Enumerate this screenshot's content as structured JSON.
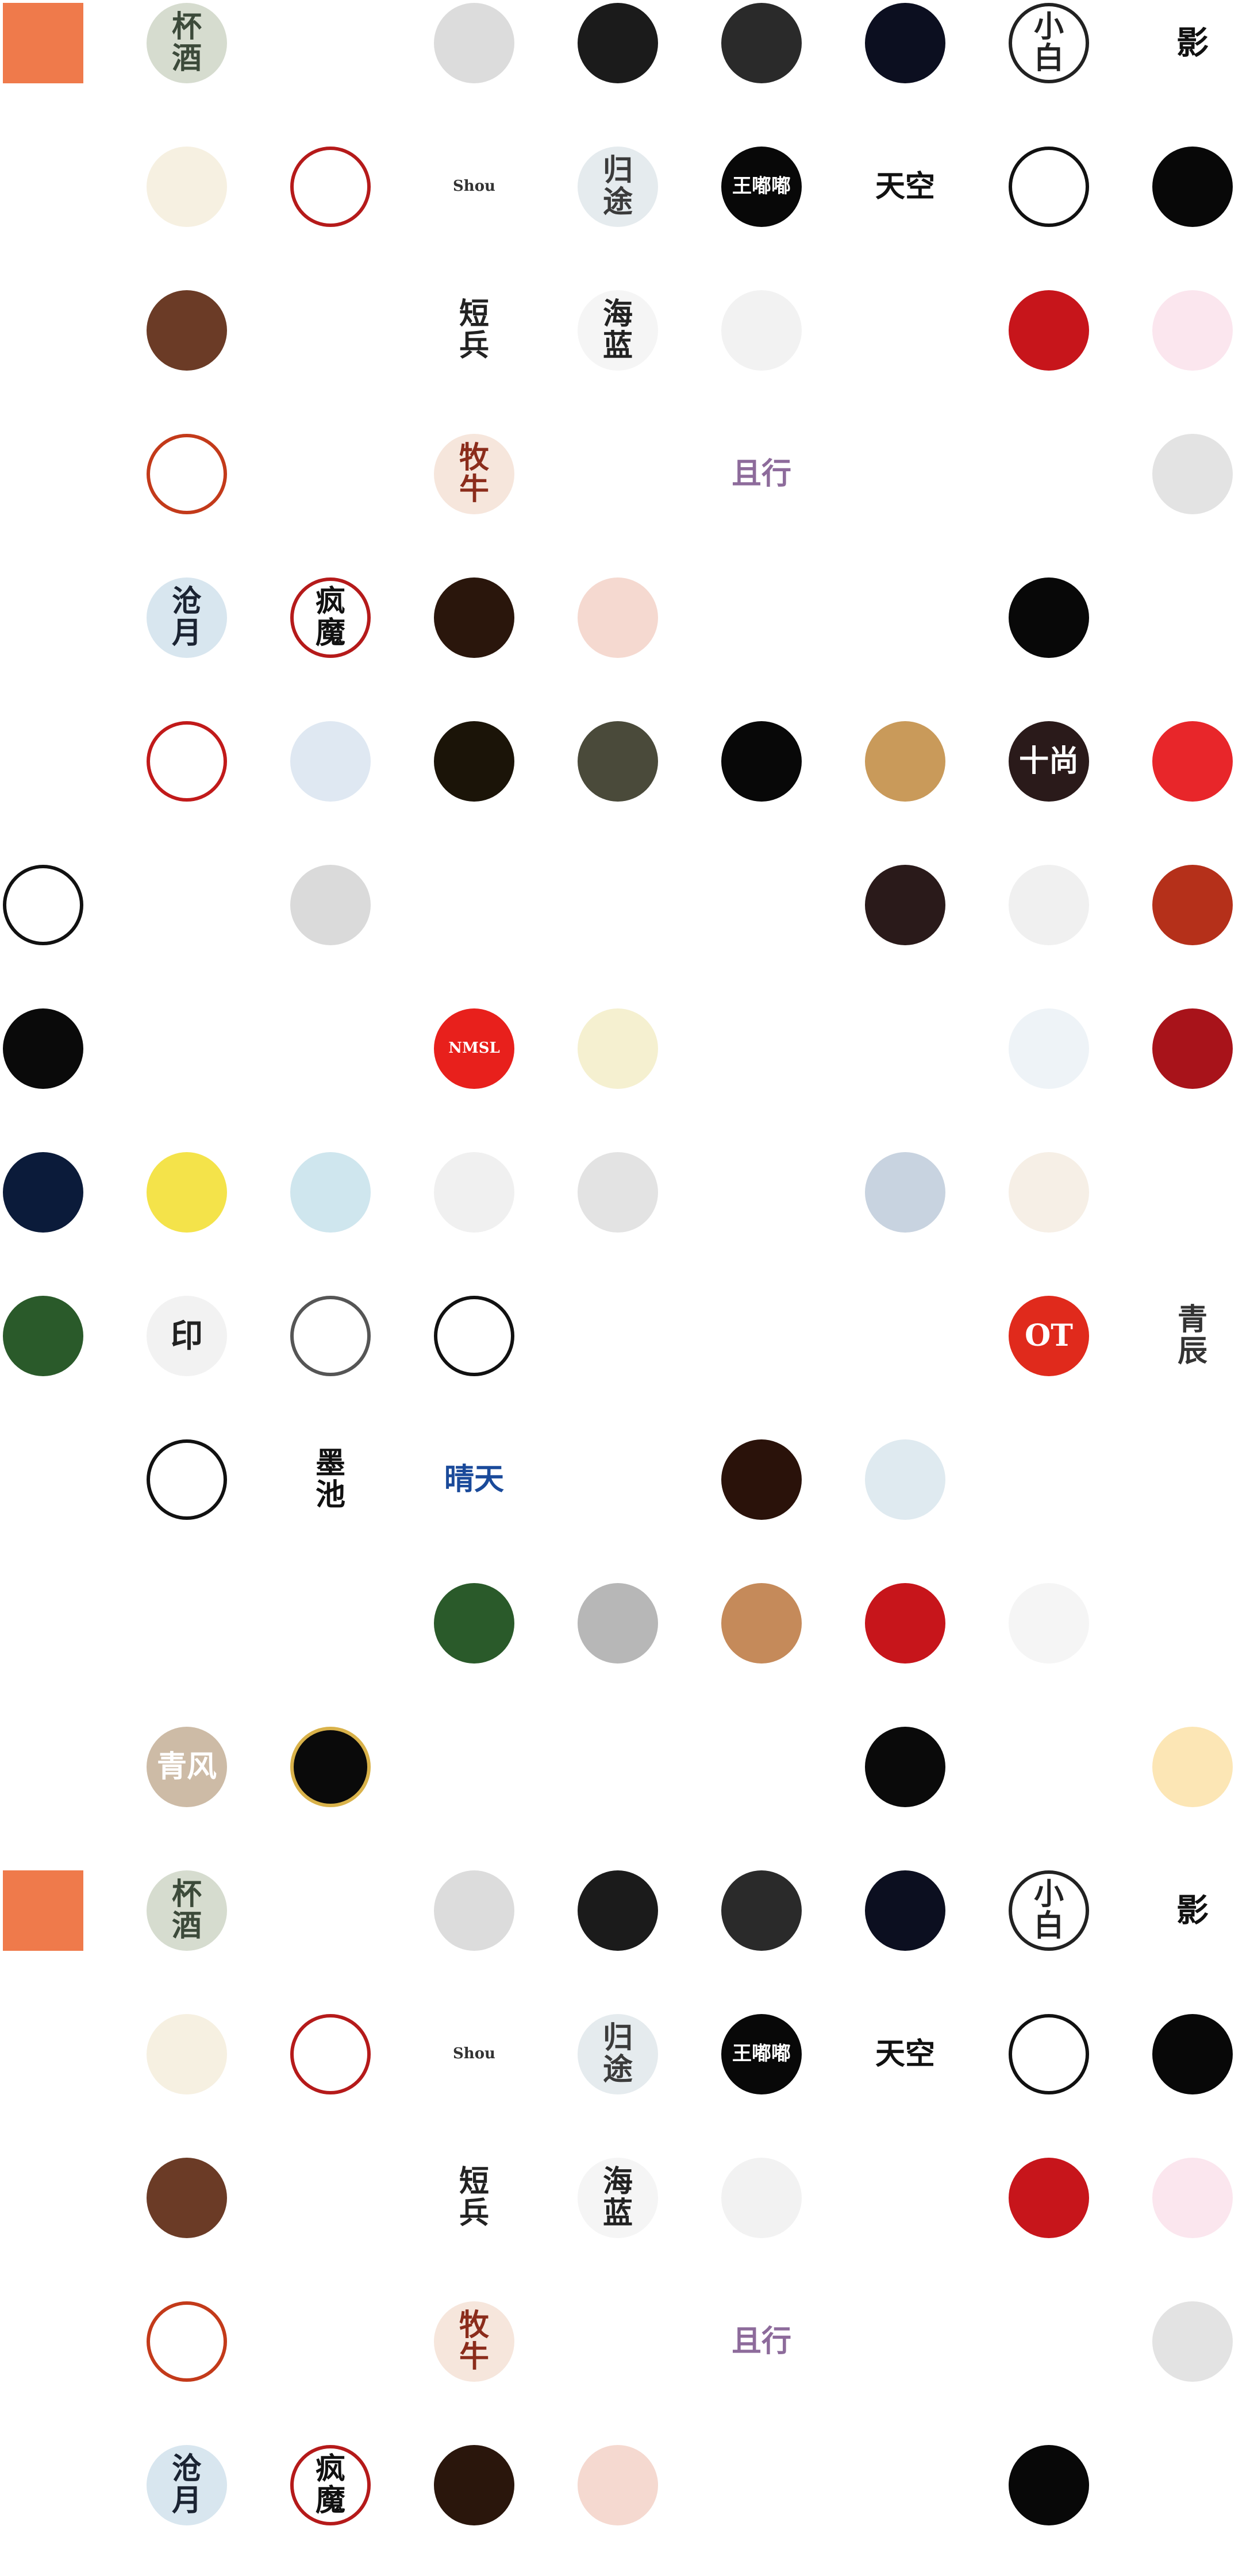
{
  "grid": {
    "columns": 9,
    "rows": 18,
    "items": [
      {
        "label": "",
        "bg": "#ef7a4b",
        "fg": "#3a1a0a",
        "plain": true
      },
      {
        "label": "杯\n酒",
        "bg": "#d6dccf",
        "fg": "#3c4a3a"
      },
      {
        "label": "",
        "bg": "#ffffff",
        "fg": "#9aa3b0"
      },
      {
        "label": "",
        "bg": "#dcdcdc",
        "fg": "#111111"
      },
      {
        "label": "",
        "bg": "#1b1b1b",
        "fg": "#d9b24a"
      },
      {
        "label": "",
        "bg": "#2a2a2a",
        "fg": "#d9b24a"
      },
      {
        "label": "",
        "bg": "#0c0f20",
        "fg": "#c6d4ff"
      },
      {
        "label": "小\n白",
        "bg": "#ffffff",
        "fg": "#222222",
        "border": "#222222"
      },
      {
        "label": "影",
        "bg": "#ffffff",
        "fg": "#111111",
        "plain": true
      },
      {
        "label": "",
        "bg": "#ffffff",
        "fg": "#333333",
        "plain": true
      },
      {
        "label": "",
        "bg": "#f6f0e1",
        "fg": "#b24c2a"
      },
      {
        "label": "",
        "bg": "#ffffff",
        "fg": "#b51a1a",
        "border": "#b51a1a"
      },
      {
        "label": "Shou",
        "bg": "#ffffff",
        "fg": "#333333",
        "plain": true
      },
      {
        "label": "归\n途",
        "bg": "#e5ebee",
        "fg": "#3b3b3b"
      },
      {
        "label": "王嘟嘟",
        "bg": "#080808",
        "fg": "#ffffff"
      },
      {
        "label": "天空",
        "bg": "#ffffff",
        "fg": "#111111"
      },
      {
        "label": "",
        "bg": "#ffffff",
        "fg": "#b51a1a",
        "border": "#111111"
      },
      {
        "label": "",
        "bg": "#080808",
        "fg": "#ffffff"
      },
      {
        "label": "",
        "bg": "#ffffff",
        "fg": "#b8922e",
        "plain": true
      },
      {
        "label": "",
        "bg": "#6b3b26",
        "fg": "#f2c6a1"
      },
      {
        "label": "",
        "bg": "#ffffff",
        "fg": "#222222",
        "plain": true
      },
      {
        "label": "短\n兵",
        "bg": "#ffffff",
        "fg": "#222222"
      },
      {
        "label": "海\n蓝",
        "bg": "#f5f5f5",
        "fg": "#222222"
      },
      {
        "label": "",
        "bg": "#f2f2f2",
        "fg": "#222222"
      },
      {
        "label": "",
        "bg": "#ffffff",
        "fg": "#222222"
      },
      {
        "label": "",
        "bg": "#c7151b",
        "fg": "#f1c84a"
      },
      {
        "label": "",
        "bg": "#fbe6ee",
        "fg": "#c65a7b"
      },
      {
        "label": "",
        "bg": "#ffffff",
        "fg": "#c28a2a",
        "plain": true
      },
      {
        "label": "",
        "bg": "#ffffff",
        "fg": "#c33a1a",
        "border": "#c33a1a"
      },
      {
        "label": "",
        "bg": "#ffffff",
        "fg": "#6aa6a1",
        "plain": true
      },
      {
        "label": "牧\n牛",
        "bg": "#f6e6dc",
        "fg": "#8b2c1b"
      },
      {
        "label": "",
        "bg": "#ffffff",
        "fg": "#263a7a"
      },
      {
        "label": "且行",
        "bg": "#ffffff",
        "fg": "#8d6b9b",
        "plain": true
      },
      {
        "label": "",
        "bg": "#ffffff",
        "fg": "#222222"
      },
      {
        "label": "",
        "bg": "#ffffff",
        "fg": "#222222"
      },
      {
        "label": "",
        "bg": "#e3e3e3",
        "fg": "#555555"
      },
      {
        "label": "",
        "bg": "#ffffff",
        "fg": "#b51a1a",
        "plain": true
      },
      {
        "label": "沧\n月",
        "bg": "#d8e6ef",
        "fg": "#1b2433"
      },
      {
        "label": "疯\n魔",
        "bg": "#ffffff",
        "fg": "#111111",
        "border": "#b51a1a"
      },
      {
        "label": "",
        "bg": "#2a160c",
        "fg": "#d0762a"
      },
      {
        "label": "",
        "bg": "#f5d9d0",
        "fg": "#3a2a1a"
      },
      {
        "label": "",
        "bg": "#ffffff",
        "fg": "#3a5a2a"
      },
      {
        "label": "",
        "bg": "#ffffff",
        "fg": "#c39a2a"
      },
      {
        "label": "",
        "bg": "#080808",
        "fg": "#d9b24a"
      },
      {
        "label": "",
        "bg": "#ffffff",
        "fg": "#d85a5a",
        "plain": true
      },
      {
        "label": "",
        "bg": "#ffffff",
        "fg": "#222222"
      },
      {
        "label": "",
        "bg": "#ffffff",
        "fg": "#c11a1a",
        "border": "#c11a1a"
      },
      {
        "label": "",
        "bg": "#dfe8f2",
        "fg": "#2a3a6a"
      },
      {
        "label": "",
        "bg": "#1b1408",
        "fg": "#d9b24a"
      },
      {
        "label": "",
        "bg": "#4a4a3a",
        "fg": "#d9d0b0"
      },
      {
        "label": "",
        "bg": "#080808",
        "fg": "#ffffff"
      },
      {
        "label": "",
        "bg": "#c99a5a",
        "fg": "#4a2a10"
      },
      {
        "label": "十尚",
        "bg": "#2a1a1a",
        "fg": "#ffffff"
      },
      {
        "label": "",
        "bg": "#e8262a",
        "fg": "#ffffff"
      },
      {
        "label": "",
        "bg": "#ffffff",
        "fg": "#111111",
        "border": "#111111"
      },
      {
        "label": "",
        "bg": "#ffffff",
        "fg": "#222222"
      },
      {
        "label": "",
        "bg": "#dadada",
        "fg": "#222222"
      },
      {
        "label": "",
        "bg": "#ffffff",
        "fg": "#111111",
        "plain": true
      },
      {
        "label": "",
        "bg": "#ffffff",
        "fg": "#222222"
      },
      {
        "label": "",
        "bg": "#ffffff",
        "fg": "#b08a3a"
      },
      {
        "label": "",
        "bg": "#2a1a1a",
        "fg": "#f0c05a"
      },
      {
        "label": "",
        "bg": "#f0f0f0",
        "fg": "#111111"
      },
      {
        "label": "",
        "bg": "#b5301a",
        "fg": "#ffffff"
      },
      {
        "label": "",
        "bg": "#0a0a0a",
        "fg": "#c11a1a"
      },
      {
        "label": "",
        "bg": "#ffffff",
        "fg": "#222222"
      },
      {
        "label": "",
        "bg": "#ffffff",
        "fg": "#2a5a9a"
      },
      {
        "label": "NMSL",
        "bg": "#e8201c",
        "fg": "#ffffff"
      },
      {
        "label": "",
        "bg": "#f5f0d0",
        "fg": "#c39a2a"
      },
      {
        "label": "",
        "bg": "#ffffff",
        "fg": "#b08a3a",
        "plain": true
      },
      {
        "label": "",
        "bg": "#ffffff",
        "fg": "#222222"
      },
      {
        "label": "",
        "bg": "#eef3f7",
        "fg": "#3a5a8a"
      },
      {
        "label": "",
        "bg": "#a8131a",
        "fg": "#f5e3c3"
      },
      {
        "label": "",
        "bg": "#0b1b3a",
        "fg": "#c9d8ff"
      },
      {
        "label": "",
        "bg": "#f4e34a",
        "fg": "#222222"
      },
      {
        "label": "",
        "bg": "#cfe6ee",
        "fg": "#ffffff"
      },
      {
        "label": "",
        "bg": "#f0f0f0",
        "fg": "#222222"
      },
      {
        "label": "",
        "bg": "#e3e3e3",
        "fg": "#222222"
      },
      {
        "label": "",
        "bg": "#ffffff",
        "fg": "#111111",
        "plain": true
      },
      {
        "label": "",
        "bg": "#c8d3e0",
        "fg": "#222222"
      },
      {
        "label": "",
        "bg": "#f6efe6",
        "fg": "#222222"
      },
      {
        "label": "",
        "bg": "#ffffff",
        "fg": "#111111",
        "plain": true
      },
      {
        "label": "",
        "bg": "#2a5a2a",
        "fg": "#3fcf3f"
      },
      {
        "label": "印",
        "bg": "#f2f2f2",
        "fg": "#222222"
      },
      {
        "label": "",
        "bg": "#ffffff",
        "fg": "#111111",
        "border": "#555555"
      },
      {
        "label": "",
        "bg": "#ffffff",
        "fg": "#111111",
        "border": "#111111"
      },
      {
        "label": "",
        "bg": "#ffffff",
        "fg": "#111111"
      },
      {
        "label": "",
        "bg": "#ffffff",
        "fg": "#d85a5a"
      },
      {
        "label": "",
        "bg": "#ffffff",
        "fg": "#2a4a8a"
      },
      {
        "label": "OT",
        "bg": "#e02a1c",
        "fg": "#ffffff"
      },
      {
        "label": "青\n辰",
        "bg": "#ffffff",
        "fg": "#333333",
        "plain": true
      },
      {
        "label": "",
        "bg": "#ffffff",
        "fg": "#8a5ad8",
        "plain": true
      },
      {
        "label": "",
        "bg": "#ffffff",
        "fg": "#111111",
        "border": "#111111"
      },
      {
        "label": "墨\n池",
        "bg": "#ffffff",
        "fg": "#111111"
      },
      {
        "label": "晴天",
        "bg": "#ffffff",
        "fg": "#1a4a9a",
        "plain": true
      },
      {
        "label": "",
        "bg": "#ffffff",
        "fg": "#222222"
      },
      {
        "label": "",
        "bg": "#2a120a",
        "fg": "#c9761a"
      },
      {
        "label": "",
        "bg": "#dfeaf0",
        "fg": "#222222"
      },
      {
        "label": "",
        "bg": "#ffffff",
        "fg": "#5a2a8a",
        "plain": true
      },
      {
        "label": "",
        "bg": "#ffffff",
        "fg": "#222222",
        "plain": true
      },
      {
        "label": "",
        "bg": "#ffffff",
        "fg": "#b51a1a",
        "plain": true
      },
      {
        "label": "",
        "bg": "#ffffff",
        "fg": "#111111",
        "plain": true
      },
      {
        "label": "",
        "bg": "#ffffff",
        "fg": "#111111",
        "plain": true
      },
      {
        "label": "",
        "bg": "#2a5a2a",
        "fg": "#f2a13a"
      },
      {
        "label": "",
        "bg": "#b7b7b7",
        "fg": "#111111"
      },
      {
        "label": "",
        "bg": "#c58a5a",
        "fg": "#ffffff"
      },
      {
        "label": "",
        "bg": "#c7151b",
        "fg": "#ffffff"
      },
      {
        "label": "",
        "bg": "#f5f5f5",
        "fg": "#222222"
      },
      {
        "label": "",
        "bg": "#ffffff",
        "fg": "#c11a1a"
      },
      {
        "label": "",
        "bg": "#ffffff",
        "fg": "#111111",
        "plain": true
      },
      {
        "label": "青风",
        "bg": "#cdbba6",
        "fg": "#ffffff"
      },
      {
        "label": "",
        "bg": "#0a0a0a",
        "fg": "#d9b24a",
        "border": "#d9b24a"
      },
      {
        "label": "",
        "bg": "#ffffff",
        "fg": "#b51a1a",
        "plain": true
      },
      {
        "label": "",
        "bg": "#ffffff",
        "fg": "#6a3a8a",
        "plain": true
      },
      {
        "label": "",
        "bg": "#ffffff",
        "fg": "#6aa6a1"
      },
      {
        "label": "",
        "bg": "#0a0a0a",
        "fg": "#d9b24a"
      },
      {
        "label": "",
        "bg": "#ffffff",
        "fg": "#222222",
        "plain": true
      },
      {
        "label": "",
        "bg": "#fce6b5",
        "fg": "#c88a1a"
      },
      {
        "label": "",
        "bg": "#ef7a4b",
        "fg": "#3a1a0a",
        "plain": true
      },
      {
        "label": "杯\n酒",
        "bg": "#d6dccf",
        "fg": "#3c4a3a"
      },
      {
        "label": "",
        "bg": "#ffffff",
        "fg": "#9aa3b0"
      },
      {
        "label": "",
        "bg": "#dcdcdc",
        "fg": "#111111"
      },
      {
        "label": "",
        "bg": "#1b1b1b",
        "fg": "#d9b24a"
      },
      {
        "label": "",
        "bg": "#2a2a2a",
        "fg": "#d9b24a"
      },
      {
        "label": "",
        "bg": "#0c0f20",
        "fg": "#c6d4ff"
      },
      {
        "label": "小\n白",
        "bg": "#ffffff",
        "fg": "#222222",
        "border": "#222222"
      },
      {
        "label": "影",
        "bg": "#ffffff",
        "fg": "#111111",
        "plain": true
      },
      {
        "label": "",
        "bg": "#ffffff",
        "fg": "#333333",
        "plain": true
      },
      {
        "label": "",
        "bg": "#f6f0e1",
        "fg": "#b24c2a"
      },
      {
        "label": "",
        "bg": "#ffffff",
        "fg": "#b51a1a",
        "border": "#b51a1a"
      },
      {
        "label": "Shou",
        "bg": "#ffffff",
        "fg": "#333333",
        "plain": true
      },
      {
        "label": "归\n途",
        "bg": "#e5ebee",
        "fg": "#3b3b3b"
      },
      {
        "label": "王嘟嘟",
        "bg": "#080808",
        "fg": "#ffffff"
      },
      {
        "label": "天空",
        "bg": "#ffffff",
        "fg": "#111111"
      },
      {
        "label": "",
        "bg": "#ffffff",
        "fg": "#b51a1a",
        "border": "#111111"
      },
      {
        "label": "",
        "bg": "#080808",
        "fg": "#ffffff"
      },
      {
        "label": "",
        "bg": "#ffffff",
        "fg": "#b8922e",
        "plain": true
      },
      {
        "label": "",
        "bg": "#6b3b26",
        "fg": "#f2c6a1"
      },
      {
        "label": "",
        "bg": "#ffffff",
        "fg": "#222222",
        "plain": true
      },
      {
        "label": "短\n兵",
        "bg": "#ffffff",
        "fg": "#222222"
      },
      {
        "label": "海\n蓝",
        "bg": "#f5f5f5",
        "fg": "#222222"
      },
      {
        "label": "",
        "bg": "#f2f2f2",
        "fg": "#222222"
      },
      {
        "label": "",
        "bg": "#ffffff",
        "fg": "#222222"
      },
      {
        "label": "",
        "bg": "#c7151b",
        "fg": "#f1c84a"
      },
      {
        "label": "",
        "bg": "#fbe6ee",
        "fg": "#c65a7b"
      },
      {
        "label": "",
        "bg": "#ffffff",
        "fg": "#c28a2a",
        "plain": true
      },
      {
        "label": "",
        "bg": "#ffffff",
        "fg": "#c33a1a",
        "border": "#c33a1a"
      },
      {
        "label": "",
        "bg": "#ffffff",
        "fg": "#6aa6a1",
        "plain": true
      },
      {
        "label": "牧\n牛",
        "bg": "#f6e6dc",
        "fg": "#8b2c1b"
      },
      {
        "label": "",
        "bg": "#ffffff",
        "fg": "#263a7a"
      },
      {
        "label": "且行",
        "bg": "#ffffff",
        "fg": "#8d6b9b",
        "plain": true
      },
      {
        "label": "",
        "bg": "#ffffff",
        "fg": "#222222"
      },
      {
        "label": "",
        "bg": "#ffffff",
        "fg": "#222222"
      },
      {
        "label": "",
        "bg": "#e3e3e3",
        "fg": "#555555"
      },
      {
        "label": "",
        "bg": "#ffffff",
        "fg": "#b51a1a",
        "plain": true
      },
      {
        "label": "沧\n月",
        "bg": "#d8e6ef",
        "fg": "#1b2433"
      },
      {
        "label": "疯\n魔",
        "bg": "#ffffff",
        "fg": "#111111",
        "border": "#b51a1a"
      },
      {
        "label": "",
        "bg": "#2a160c",
        "fg": "#d0762a"
      },
      {
        "label": "",
        "bg": "#f5d9d0",
        "fg": "#3a2a1a"
      },
      {
        "label": "",
        "bg": "#ffffff",
        "fg": "#3a5a2a"
      },
      {
        "label": "",
        "bg": "#ffffff",
        "fg": "#c39a2a"
      },
      {
        "label": "",
        "bg": "#080808",
        "fg": "#d9b24a"
      },
      {
        "label": "",
        "bg": "#ffffff",
        "fg": "#d85a5a",
        "plain": true
      }
    ]
  }
}
